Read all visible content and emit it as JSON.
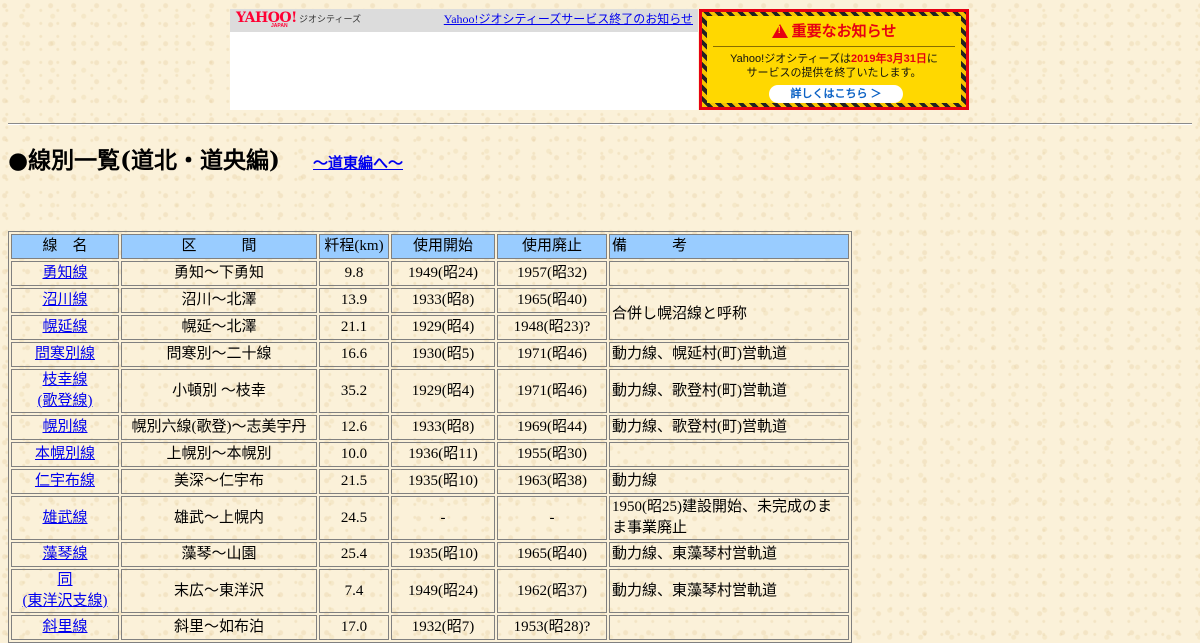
{
  "ad": {
    "logo_text": "YAHOO!",
    "logo_sub": "JAPAN",
    "brand": "ジオシティーズ",
    "notice_link": "Yahoo!ジオシティーズサービス終了のお知らせ",
    "alert_title": "重要なお知らせ",
    "alert_line1_pre": "Yahoo!ジオシティーズは",
    "alert_line1_date": "2019年3月31日",
    "alert_line1_post": "に",
    "alert_line2": "サービスの提供を終了いたします。",
    "alert_button": "詳しくはこちら ＞",
    "colors": {
      "alert_red": "#e60012",
      "alert_yellow": "#ffd800"
    }
  },
  "page": {
    "title": "●線別一覧(道北・道央編)",
    "east_link": "～道東編へ～"
  },
  "table": {
    "header_color": "#99ccff",
    "headers": {
      "line": "線　名",
      "section": "区　　　間",
      "km": "粁程(km)",
      "opened": "使用開始",
      "closed": "使用廃止",
      "note": "備　　　考"
    },
    "rows": [
      {
        "line": "勇知線",
        "section": "勇知～下勇知",
        "km": "9.8",
        "opened": "1949(昭24)",
        "closed": "1957(昭32)",
        "note": ""
      },
      {
        "line": "沼川線",
        "section": "沼川～北澤",
        "km": "13.9",
        "opened": "1933(昭8)",
        "closed": "1965(昭40)",
        "note": "合併し幌沼線と呼称"
      },
      {
        "line": "幌延線",
        "section": "幌延～北澤",
        "km": "21.1",
        "opened": "1929(昭4)",
        "closed": "1948(昭23)?",
        "note": ""
      },
      {
        "line": "問寒別線",
        "section": "問寒別～二十線",
        "km": "16.6",
        "opened": "1930(昭5)",
        "closed": "1971(昭46)",
        "note": "動力線、幌延村(町)営軌道"
      },
      {
        "line": "枝幸線",
        "line_sub": "(歌登線)",
        "section": "小頓別 ～枝幸",
        "km": "35.2",
        "opened": "1929(昭4)",
        "closed": "1971(昭46)",
        "note": "動力線、歌登村(町)営軌道"
      },
      {
        "line": "幌別線",
        "section": "幌別六線(歌登)～志美宇丹",
        "km": "12.6",
        "opened": "1933(昭8)",
        "closed": "1969(昭44)",
        "note": "動力線、歌登村(町)営軌道"
      },
      {
        "line": "本幌別線",
        "section": "上幌別～本幌別",
        "km": "10.0",
        "opened": "1936(昭11)",
        "closed": "1955(昭30)",
        "note": ""
      },
      {
        "line": "仁宇布線",
        "section": "美深～仁宇布",
        "km": "21.5",
        "opened": "1935(昭10)",
        "closed": "1963(昭38)",
        "note": "動力線"
      },
      {
        "line": "雄武線",
        "section": "雄武～上幌内",
        "km": "24.5",
        "opened": "-",
        "closed": "-",
        "note": "1950(昭25)建設開始、未完成のまま事業廃止"
      },
      {
        "line": "藻琴線",
        "section": "藻琴～山園",
        "km": "25.4",
        "opened": "1935(昭10)",
        "closed": "1965(昭40)",
        "note": "動力線、東藻琴村営軌道"
      },
      {
        "line": "同",
        "line_sub": "(東洋沢支線)",
        "section": "末広～東洋沢",
        "km": "7.4",
        "opened": "1949(昭24)",
        "closed": "1962(昭37)",
        "note": "動力線、東藻琴村営軌道"
      },
      {
        "line": "斜里線",
        "section": "斜里～如布泊",
        "km": "17.0",
        "opened": "1932(昭7)",
        "closed": "1953(昭28)?",
        "note": ""
      }
    ]
  }
}
